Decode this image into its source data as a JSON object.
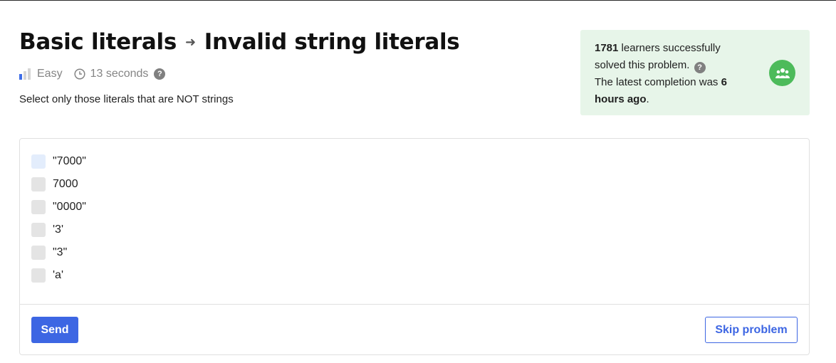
{
  "header": {
    "topic": "Basic literals",
    "separator_icon": "arrow-right-icon",
    "title": "Invalid string literals",
    "difficulty": "Easy",
    "difficulty_level": "1 of 3 bars",
    "time": "13 seconds",
    "help_glyph": "?"
  },
  "instruction": "Select only those literals that are NOT strings",
  "stats": {
    "count": "1781",
    "text1": " learners successfully solved this problem.",
    "text2": "The latest completion was ",
    "recent": "6 hours ago",
    "end": ".",
    "help_glyph": "?",
    "icon": "group-icon",
    "background": "#e7f5e9",
    "icon_color": "#4dbb5b"
  },
  "options": [
    {
      "label": "\"7000\""
    },
    {
      "label": "7000"
    },
    {
      "label": "\"0000\""
    },
    {
      "label": "'3'"
    },
    {
      "label": "\"3\""
    },
    {
      "label": "'a'"
    }
  ],
  "actions": {
    "send_label": "Send",
    "skip_label": "Skip problem",
    "accent": "#3d66e3"
  }
}
